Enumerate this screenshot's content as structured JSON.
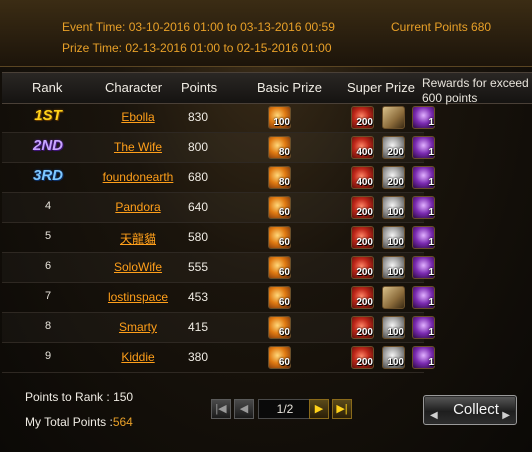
{
  "header": {
    "event_time_label": "Event Time:",
    "event_time_value": "03-10-2016 01:00 to 03-13-2016 00:59",
    "prize_time_label": "Prize Time:",
    "prize_time_value": "02-13-2016 01:00 to 02-15-2016 01:00",
    "current_points_label": "Current Points",
    "current_points_value": "680"
  },
  "columns": {
    "rank": "Rank",
    "character": "Character",
    "points": "Points",
    "basic_prize": "Basic Prize",
    "super_prize": "Super Prize",
    "rewards_note": "Rewards for exceed 600 points"
  },
  "rows": [
    {
      "rank": "1ST",
      "character": "Ebolla",
      "points": "830",
      "basic": "100",
      "super1": "200",
      "super2": "",
      "bonus": "1"
    },
    {
      "rank": "2ND",
      "character": "The Wife",
      "points": "800",
      "basic": "80",
      "super1": "400",
      "super2": "200",
      "bonus": "1"
    },
    {
      "rank": "3RD",
      "character": "foundonearth",
      "points": "680",
      "basic": "80",
      "super1": "400",
      "super2": "200",
      "bonus": "1"
    },
    {
      "rank": "4",
      "character": "Pandora",
      "points": "640",
      "basic": "60",
      "super1": "200",
      "super2": "100",
      "bonus": "1"
    },
    {
      "rank": "5",
      "character": "天龍貓",
      "points": "580",
      "basic": "60",
      "super1": "200",
      "super2": "100",
      "bonus": "1"
    },
    {
      "rank": "6",
      "character": "SoloWife",
      "points": "555",
      "basic": "60",
      "super1": "200",
      "super2": "100",
      "bonus": "1"
    },
    {
      "rank": "7",
      "character": "lostinspace",
      "points": "453",
      "basic": "60",
      "super1": "200",
      "super2": "",
      "bonus": "1"
    },
    {
      "rank": "8",
      "character": "Smarty",
      "points": "415",
      "basic": "60",
      "super1": "200",
      "super2": "100",
      "bonus": "1"
    },
    {
      "rank": "9",
      "character": "Kiddie",
      "points": "380",
      "basic": "60",
      "super1": "200",
      "super2": "100",
      "bonus": "1"
    }
  ],
  "footer": {
    "points_to_rank_label": "Points to Rank :",
    "points_to_rank_value": "150",
    "total_points_label": "My Total Points :",
    "total_points_value": "564",
    "page_indicator": "1/2",
    "collect_label": "Collect"
  },
  "icons": {
    "basic_prize": "gold-coin-icon",
    "super_prize_1": "red-orb-icon",
    "super_prize_2": "silver-orb-icon",
    "super_prize_scroll": "scroll-icon",
    "bonus_reward": "purple-gem-icon",
    "pager_first": "first-page-icon",
    "pager_prev": "prev-page-icon",
    "pager_next": "next-page-icon",
    "pager_last": "last-page-icon"
  },
  "colors": {
    "accent_orange": "#e8a028",
    "link_orange": "#ff9f1a",
    "rank_gold": "#ffd21a",
    "rank_purple": "#c7a3ff",
    "rank_blue": "#7ec7ff"
  }
}
